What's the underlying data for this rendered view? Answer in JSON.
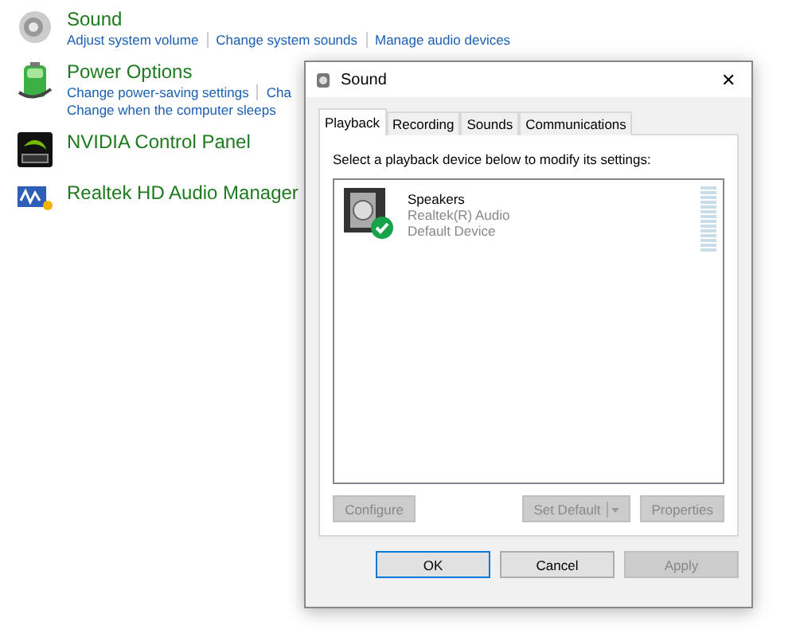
{
  "control_panel": {
    "items": [
      {
        "kind": "speaker",
        "title": "Sound",
        "links": [
          [
            "Adjust system volume",
            "Change system sounds",
            "Manage audio devices"
          ]
        ]
      },
      {
        "kind": "battery",
        "title": "Power Options",
        "links": [
          [
            "Change power-saving settings",
            "Cha"
          ],
          [
            "Change when the computer sleeps"
          ]
        ]
      },
      {
        "kind": "gpu",
        "title": "NVIDIA Control Panel"
      },
      {
        "kind": "audio",
        "title": "Realtek HD Audio Manager"
      }
    ]
  },
  "dialog": {
    "title": "Sound",
    "close": "✕",
    "tabs": [
      {
        "label": "Playback",
        "selected": true
      },
      {
        "label": "Recording",
        "selected": false
      },
      {
        "label": "Sounds",
        "selected": false
      },
      {
        "label": "Communications",
        "selected": false
      }
    ],
    "instruction": "Select a playback device below to modify its settings:",
    "devices": [
      {
        "name": "Speakers",
        "driver": "Realtek(R) Audio",
        "status": "Default Device",
        "default": true
      }
    ],
    "device_buttons": [
      {
        "label": "Configure",
        "disabled": true,
        "split": false
      },
      {
        "label": "Set Default",
        "disabled": true,
        "split": true
      },
      {
        "label": "Properties",
        "disabled": true,
        "split": false
      }
    ],
    "buttons": [
      {
        "label": "OK",
        "disabled": false,
        "default": true
      },
      {
        "label": "Cancel",
        "disabled": false,
        "default": false
      },
      {
        "label": "Apply",
        "disabled": true,
        "default": false
      }
    ]
  }
}
